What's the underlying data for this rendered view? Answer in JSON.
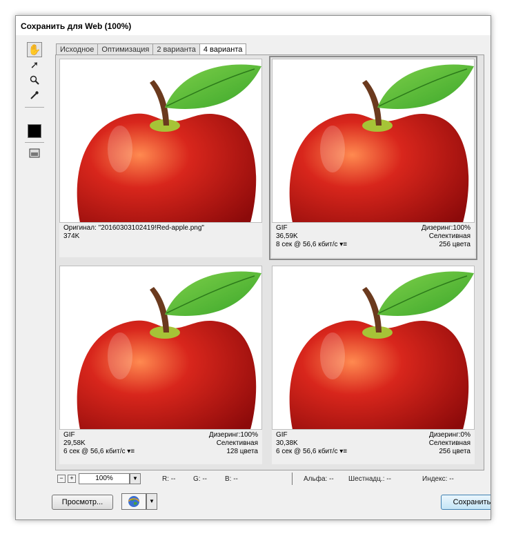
{
  "window": {
    "title": "Сохранить для Web (100%)"
  },
  "tabs": [
    "Исходное",
    "Оптимизация",
    "2 варианта",
    "4 варианта"
  ],
  "active_tab": "4 варианта",
  "toolbar": {
    "tools": [
      "hand-icon",
      "slice-select-icon",
      "zoom-icon",
      "eyedropper-icon"
    ],
    "eyedropper_color": "#000000",
    "toggle_slices": "toggle-slices-icon"
  },
  "panels": [
    {
      "line1_left": "Оригинал: \"20160303102419!Red-apple.png\"",
      "line1_right": "",
      "line2_left": "374K",
      "line2_right": "",
      "line3_left": "",
      "line3_right": ""
    },
    {
      "line1_left": "GIF",
      "line1_right": "Дизеринг:100%",
      "line2_left": "36,59K",
      "line2_right": "Селективная",
      "line3_left": "8 сек @ 56,6 кбит/с",
      "line3_right": "256 цвета"
    },
    {
      "line1_left": "GIF",
      "line1_right": "Дизеринг:100%",
      "line2_left": "29,58K",
      "line2_right": "Селективная",
      "line3_left": "6 сек @ 56,6 кбит/с",
      "line3_right": "128 цвета"
    },
    {
      "line1_left": "GIF",
      "line1_right": "Дизеринг:0%",
      "line2_left": "30,38K",
      "line2_right": "Селективная",
      "line3_left": "6 сек @ 56,6 кбит/с",
      "line3_right": "256 цвета"
    }
  ],
  "status": {
    "zoom_minus": "−",
    "zoom_plus": "+",
    "zoom": "100%",
    "r": "R: --",
    "g": "G: --",
    "b": "B: --",
    "alpha": "Альфа: --",
    "hex": "Шестнадц.: --",
    "index": "Индекс: --"
  },
  "buttons": {
    "preview": "Просмотр...",
    "save": "Сохранить"
  },
  "colors": {
    "apple_red": "#d8261c",
    "leaf_green": "#3aa62a",
    "stem_brown": "#6b3a1e"
  }
}
